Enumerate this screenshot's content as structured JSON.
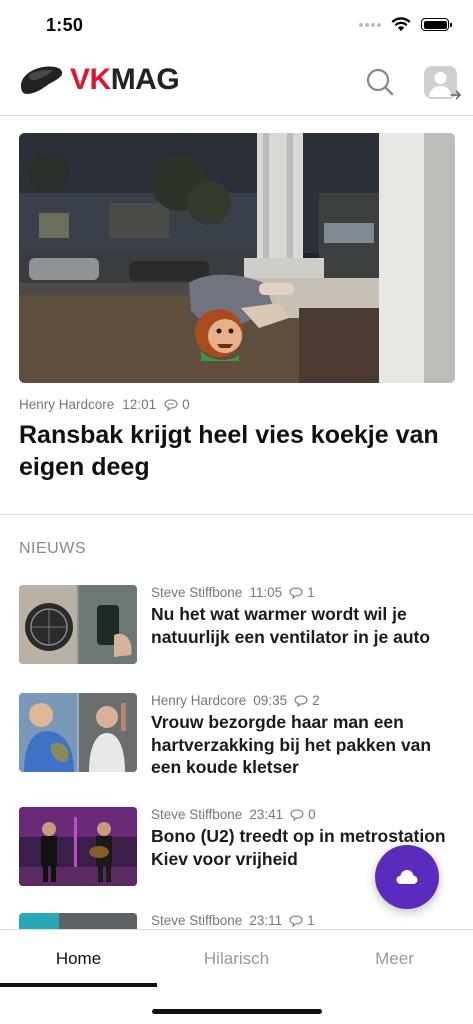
{
  "status": {
    "time": "1:50"
  },
  "header": {
    "brand_red": "VK",
    "brand_dark": "MAG",
    "accent": "#e3122d"
  },
  "hero": {
    "author": "Henry Hardcore",
    "time": "12:01",
    "comments": "0",
    "title": "Ransbak krijgt heel vies koekje van eigen deeg"
  },
  "section": {
    "label": "NIEUWS"
  },
  "news": [
    {
      "author": "Steve Stiffbone",
      "time": "11:05",
      "comments": "1",
      "title": "Nu het wat warmer wordt wil je natuurlijk een ventilator in je auto"
    },
    {
      "author": "Henry Hardcore",
      "time": "09:35",
      "comments": "2",
      "title": "Vrouw bezorgde haar man een hartverzakking bij het pakken van een koude kletser"
    },
    {
      "author": "Steve Stiffbone",
      "time": "23:41",
      "comments": "0",
      "title": "Bono (U2) treedt op in metrostation Kiev voor vrijheid"
    },
    {
      "author": "Steve Stiffbone",
      "time": "23:11",
      "comments": "1",
      "title": ""
    }
  ],
  "fab": {
    "icon": "cloud-icon",
    "color": "#5b2bbd"
  },
  "tabs": [
    {
      "label": "Home",
      "active": true
    },
    {
      "label": "Hilarisch",
      "active": false
    },
    {
      "label": "Meer",
      "active": false
    }
  ]
}
